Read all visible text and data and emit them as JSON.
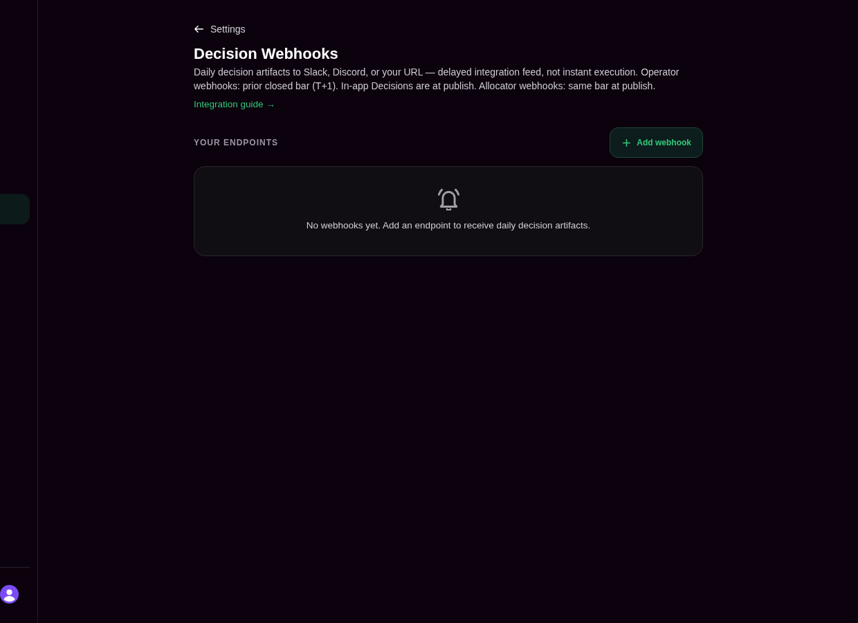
{
  "sidebar": {
    "items": [
      {
        "selected": true
      }
    ]
  },
  "back_link": {
    "label": "Settings"
  },
  "page": {
    "title": "Decision Webhooks",
    "description": "Daily decision artifacts to Slack, Discord, or your URL — delayed integration feed, not instant execution. Operator webhooks: prior closed bar (T+1). In-app Decisions are at publish. Allocator webhooks: same bar at publish.",
    "guide_link": "Integration guide →"
  },
  "endpoints": {
    "heading": "YOUR ENDPOINTS",
    "add_button": "Add webhook",
    "empty_state": {
      "message": "No webhooks yet. Add an endpoint to receive daily decision artifacts."
    }
  }
}
